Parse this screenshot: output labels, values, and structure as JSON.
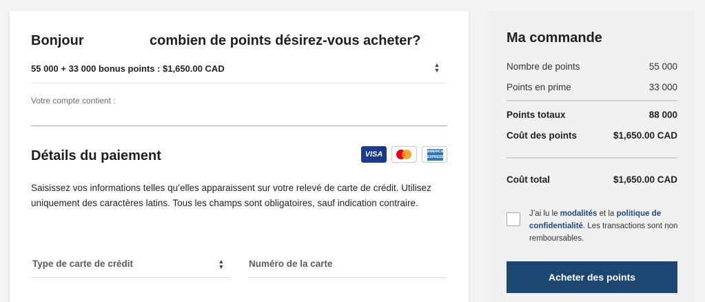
{
  "purchase": {
    "greeting_hello": "Bonjour",
    "greeting_question": "combien de points désirez-vous acheter?",
    "package_value": "55 000 + 33 000 bonus points : $1,650.00 CAD",
    "account_note": "Votre compte contient :"
  },
  "payment": {
    "title": "Détails du paiement",
    "cards": {
      "visa": "VISA",
      "amex": "AMERICAN EXPRESS",
      "icons": [
        "visa-logo",
        "mastercard-logo",
        "amex-logo"
      ]
    },
    "instructions": "Saisissez vos informations telles qu’elles apparaissent sur votre relevé de carte de crédit. Utilisez uniquement des caractères latins. Tous les champs sont obligatoires, sauf indication contraire.",
    "card_type_label": "Type de carte de crédit",
    "card_number_label": "Numéro de la carte"
  },
  "order": {
    "title": "Ma commande",
    "rows": [
      {
        "label": "Nombre de points",
        "value": "55 000"
      },
      {
        "label": "Points en prime",
        "value": "33 000"
      },
      {
        "label": "Points totaux",
        "value": "88 000"
      },
      {
        "label": "Coût des points",
        "value": "$1,650.00 CAD"
      },
      {
        "label": "Coût total",
        "value": "$1,650.00 CAD"
      }
    ],
    "terms": {
      "pre": "J’ai lu le ",
      "link1": "modalités",
      "mid": " et la ",
      "link2": "politique de confidentialité",
      "post": ". Les transactions sont non remboursables."
    },
    "buy_label": "Acheter des points"
  },
  "colors": {
    "accent": "#1c4772",
    "divider_gold": "#b7a27c",
    "link": "#1e4a7d"
  }
}
